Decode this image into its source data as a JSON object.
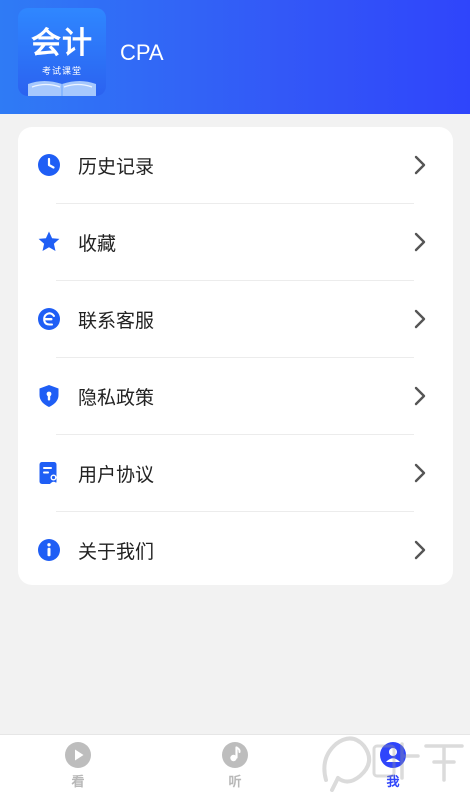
{
  "header": {
    "logo_title": "会计",
    "logo_subtitle": "考试课堂",
    "app_name": "CPA"
  },
  "menu": {
    "items": [
      {
        "label": "历史记录",
        "icon": "clock-icon"
      },
      {
        "label": "收藏",
        "icon": "star-icon"
      },
      {
        "label": "联系客服",
        "icon": "headset-icon"
      },
      {
        "label": "隐私政策",
        "icon": "shield-icon"
      },
      {
        "label": "用户协议",
        "icon": "document-icon"
      },
      {
        "label": "关于我们",
        "icon": "info-icon"
      }
    ]
  },
  "tabbar": {
    "tabs": [
      {
        "label": "看",
        "icon": "play-icon",
        "active": false
      },
      {
        "label": "听",
        "icon": "music-note-icon",
        "active": false
      },
      {
        "label": "我",
        "icon": "profile-icon",
        "active": true
      }
    ]
  },
  "colors": {
    "accent": "#2f45fb",
    "icon_blue": "#1f5ef5",
    "inactive": "#b8b8b8"
  }
}
